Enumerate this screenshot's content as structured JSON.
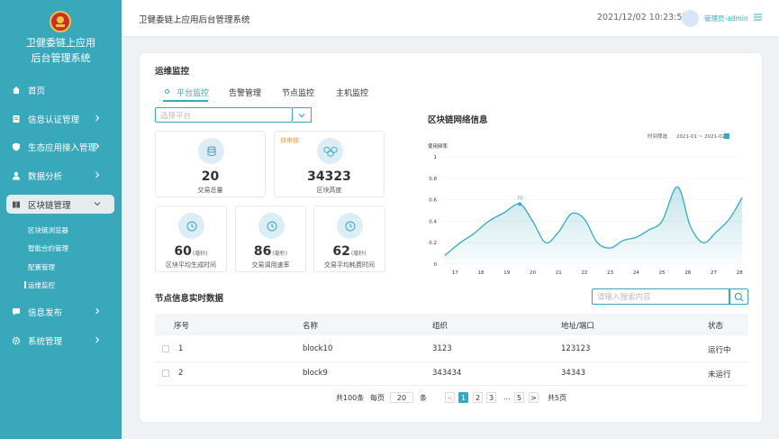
{
  "app": {
    "title_line1": "卫健委链上应用",
    "title_line2": "后台管理系统",
    "header_title": "卫健委链上应用后台管理系统",
    "datetime": "2021/12/02 10:23:57",
    "user": "管理员-admin"
  },
  "sidebar": {
    "items": [
      {
        "label": "首页",
        "icon": "home-icon"
      },
      {
        "label": "信息认证管理",
        "icon": "document-icon"
      },
      {
        "label": "生态应用接入管理",
        "icon": "shield-icon"
      },
      {
        "label": "数据分析",
        "icon": "user-icon"
      },
      {
        "label": "区块链管理",
        "icon": "book-icon"
      },
      {
        "label": "信息发布",
        "icon": "chat-icon"
      },
      {
        "label": "系统管理",
        "icon": "gear-icon"
      }
    ],
    "subitems": [
      "区块链浏览器",
      "智能合约管理",
      "配置管理",
      "运维监控"
    ]
  },
  "main": {
    "section_title": "运维监控",
    "tabs": [
      "平台监控",
      "告警管理",
      "节点监控",
      "主机监控"
    ],
    "select_placeholder": "选择平台",
    "stats": [
      {
        "value": "20",
        "label": "交易总量",
        "unit": "",
        "badge": ""
      },
      {
        "value": "34323",
        "label": "区块高度",
        "unit": "",
        "badge": "待审核"
      },
      {
        "value": "60",
        "label": "区块平均生成时间",
        "unit": "(毫秒)",
        "badge": ""
      },
      {
        "value": "86",
        "label": "交易调用速率",
        "unit": "(毫秒)",
        "badge": ""
      },
      {
        "value": "62",
        "label": "交易平均耗费时间",
        "unit": "(毫秒)",
        "badge": ""
      }
    ],
    "chart_title": "区块链网络信息",
    "chart_filter_label": "时间筛选",
    "chart_filter_range": "2021-01 ~ 2021-02",
    "table_title": "节点信息实时数据",
    "search_placeholder": "请输入搜索内容",
    "table": {
      "headers": [
        "序号",
        "名称",
        "组织",
        "地址/端口",
        "状态"
      ],
      "rows": [
        [
          "1",
          "block10",
          "3123",
          "123123",
          "运行中"
        ],
        [
          "2",
          "block9",
          "343434",
          "34343",
          "未运行"
        ]
      ]
    },
    "pagination": {
      "total": "共100条",
      "per_page_label": "每页",
      "per_page": "20",
      "per_page_unit": "条",
      "pages": [
        "1",
        "2",
        "3",
        "...",
        "5"
      ],
      "total_pages": "共5页",
      "prev": "<",
      "next": ">"
    }
  },
  "colors": {
    "accent": "#3aa8bb",
    "badge": "#e8964a"
  },
  "chart_data": {
    "type": "area",
    "title": "区块链网络信息",
    "ylabel": "使用频率",
    "xlabel": "",
    "ylim": [
      0,
      1
    ],
    "yticks": [
      "0",
      "0.2",
      "0.4",
      "0.6",
      "0.8",
      "1"
    ],
    "x": [
      17,
      18,
      19,
      20,
      21,
      22,
      23,
      24,
      25,
      26,
      27,
      28
    ],
    "highlight": {
      "x": 19.5,
      "label": "70"
    },
    "points": [
      [
        16.6,
        0.08
      ],
      [
        17.2,
        0.2
      ],
      [
        17.7,
        0.28
      ],
      [
        18.3,
        0.4
      ],
      [
        18.9,
        0.48
      ],
      [
        19.5,
        0.56
      ],
      [
        20.0,
        0.4
      ],
      [
        20.5,
        0.2
      ],
      [
        21.0,
        0.3
      ],
      [
        21.5,
        0.47
      ],
      [
        22.0,
        0.42
      ],
      [
        22.5,
        0.2
      ],
      [
        23.0,
        0.15
      ],
      [
        23.5,
        0.22
      ],
      [
        24.0,
        0.25
      ],
      [
        24.5,
        0.32
      ],
      [
        25.0,
        0.4
      ],
      [
        25.6,
        0.72
      ],
      [
        26.1,
        0.35
      ],
      [
        26.6,
        0.2
      ],
      [
        27.1,
        0.3
      ],
      [
        27.6,
        0.42
      ],
      [
        28.1,
        0.62
      ]
    ]
  }
}
